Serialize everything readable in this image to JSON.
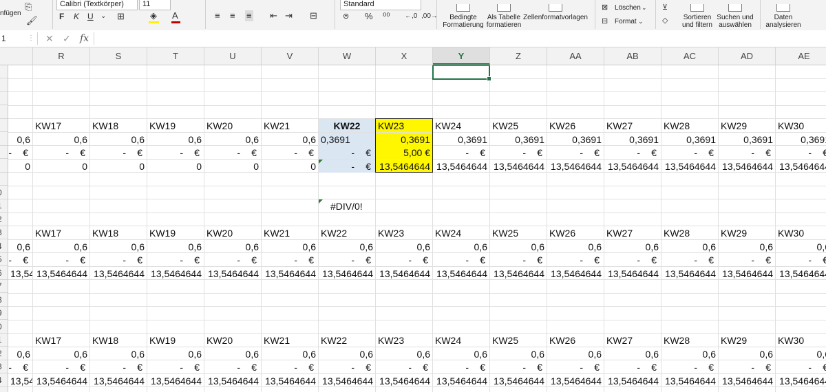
{
  "ribbon": {
    "paste_label": "nfügen",
    "font_name": "Calibri (Textkörper)",
    "font_size": "11",
    "bold": "F",
    "italic": "K",
    "underline": "U",
    "number_format": "Standard",
    "percent": "%",
    "currency": "$",
    "conditional_formatting": "Bedingte Formatierung",
    "format_as_table": "Als Tabelle formatieren",
    "cell_styles": "Zellenformatvorlagen",
    "delete": "Löschen",
    "format": "Format",
    "sort_filter": "Sortieren und filtern",
    "find_select": "Suchen und auswählen",
    "analyze_data": "Daten analysieren"
  },
  "formula_bar": {
    "name_box": "1",
    "cancel": "✕",
    "enter": "✓",
    "fx": "fx",
    "formula": ""
  },
  "columns": [
    "R",
    "S",
    "T",
    "U",
    "V",
    "W",
    "X",
    "Y",
    "Z",
    "AA",
    "AB",
    "AC",
    "AD",
    "AE"
  ],
  "selected_column": "Y",
  "row_numbers": [
    "",
    "",
    "",
    "",
    "",
    "",
    "",
    "",
    "",
    "0",
    "1",
    "2",
    "3",
    "4",
    "5",
    "6",
    "7",
    "8",
    "9",
    "0",
    "1",
    "2",
    "3",
    "4"
  ],
  "weeks": [
    "KW17",
    "KW18",
    "KW19",
    "KW20",
    "KW21",
    "KW22",
    "KW23",
    "KW24",
    "KW25",
    "KW26",
    "KW27",
    "KW28",
    "KW29",
    "KW30"
  ],
  "block1": {
    "row_a": [
      "0,6",
      "0,6",
      "0,6",
      "0,6",
      "0,6",
      "0,6",
      "0,3691",
      "0,3691",
      "0,3691",
      "0,3691",
      "0,3691",
      "0,3691",
      "0,3691",
      "0,3691",
      "0,3691"
    ],
    "row_b_x": "5,00 €",
    "row_c": [
      "0",
      "0",
      "0",
      "0",
      "0",
      "0",
      "-",
      "13,5464644",
      "13,5464644",
      "13,5464644",
      "13,5464644",
      "13,5464644",
      "13,5464644",
      "13,5464644",
      "13,5464644"
    ]
  },
  "error_value": "#DIV/0!",
  "repeat": {
    "row_a": "0,6",
    "row_c": "13,5464644",
    "dash": "-",
    "euro": "€"
  }
}
